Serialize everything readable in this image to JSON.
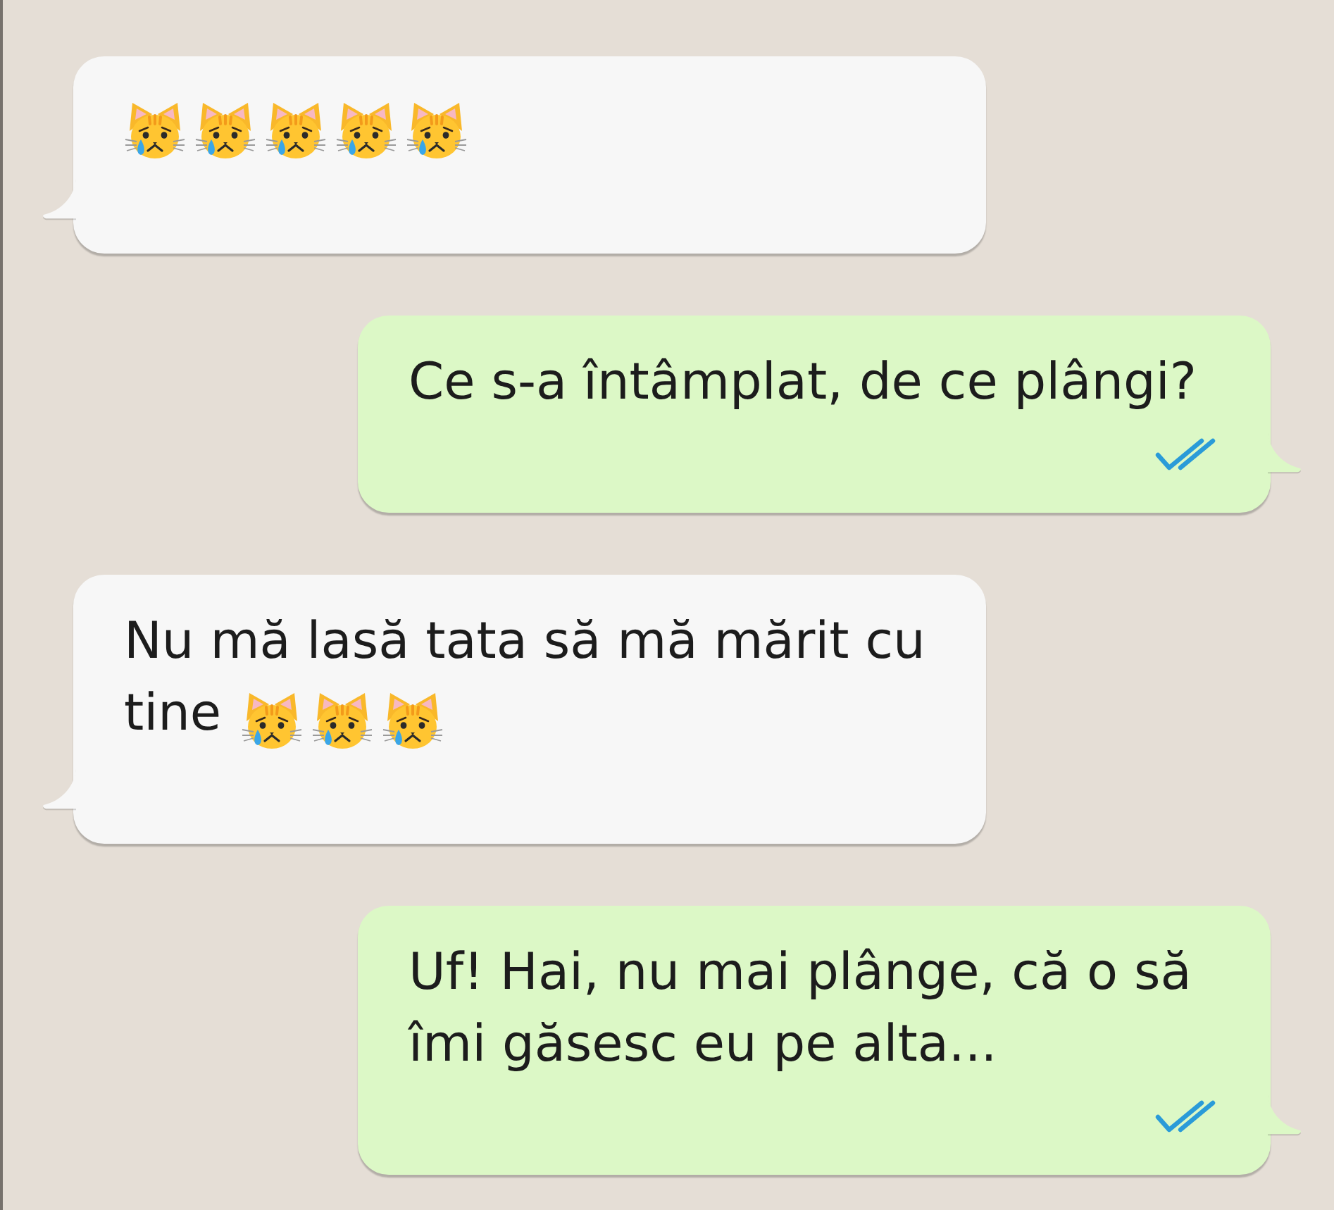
{
  "messages": [
    {
      "kind": "incoming",
      "emojis": [
        {
          "kind": "crying-cat"
        },
        {
          "kind": "crying-cat"
        },
        {
          "kind": "crying-cat"
        },
        {
          "kind": "crying-cat"
        },
        {
          "kind": "crying-cat"
        }
      ]
    },
    {
      "kind": "outgoing",
      "text": "Ce s-a întâmplat, de ce plângi?",
      "read": true
    },
    {
      "kind": "incoming",
      "lines": [
        "Nu mă lasă tata să mă mărit cu",
        "tine"
      ],
      "emojis": [
        {
          "kind": "crying-cat"
        },
        {
          "kind": "crying-cat"
        },
        {
          "kind": "crying-cat"
        }
      ]
    },
    {
      "kind": "outgoing",
      "text": "Uf! Hai, nu mai plânge, că o să îmi găsesc eu pe alta...",
      "read": true
    }
  ]
}
